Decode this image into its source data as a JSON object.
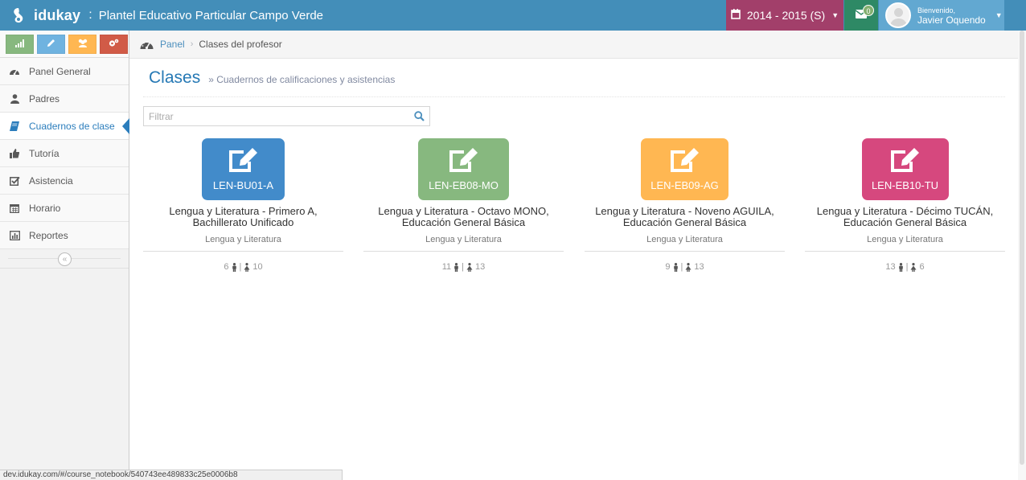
{
  "navbar": {
    "brand": "idukay",
    "separator": ":",
    "school": "Plantel Educativo Particular Campo Verde",
    "year": "2014 - 2015 (S)",
    "mail_count": "0",
    "welcome": "Bienvenido,",
    "user_name": "Javier Oquendo",
    "colors": {
      "navbar": "#438eb9",
      "year": "#a23f6a",
      "mail": "#2e8965",
      "user": "#62a8d1"
    }
  },
  "shortcuts": [
    {
      "icon": "signal-icon",
      "color": "#87b87f"
    },
    {
      "icon": "pencil-icon",
      "color": "#6fb3e0"
    },
    {
      "icon": "users-icon",
      "color": "#ffb752"
    },
    {
      "icon": "cogs-icon",
      "color": "#d15b47"
    }
  ],
  "sidebar": {
    "items": [
      {
        "label": "Panel General",
        "icon": "dashboard-icon"
      },
      {
        "label": "Padres",
        "icon": "user-icon"
      },
      {
        "label": "Cuadernos de clase",
        "icon": "book-icon",
        "active": true
      },
      {
        "label": "Tutoría",
        "icon": "thumbs-up-icon"
      },
      {
        "label": "Asistencia",
        "icon": "check-square-icon"
      },
      {
        "label": "Horario",
        "icon": "calendar-icon"
      },
      {
        "label": "Reportes",
        "icon": "bar-chart-icon"
      }
    ]
  },
  "breadcrumb": {
    "home": "Panel",
    "current": "Clases del profesor"
  },
  "header": {
    "title": "Clases",
    "subtitle": "» Cuadernos de calificaciones y asistencias"
  },
  "filter": {
    "placeholder": "Filtrar",
    "value": ""
  },
  "courses": [
    {
      "code": "LEN-BU01-A",
      "title_line1": "Lengua y Literatura - Primero A,",
      "title_line2": "Bachillerato Unificado",
      "subject": "Lengua y Literatura",
      "males": "6",
      "females": "10",
      "color": "#428bca"
    },
    {
      "code": "LEN-EB08-MO",
      "title_line1": "Lengua y Literatura - Octavo MONO,",
      "title_line2": "Educación General Básica",
      "subject": "Lengua y Literatura",
      "males": "11",
      "females": "13",
      "color": "#87b87f"
    },
    {
      "code": "LEN-EB09-AG",
      "title_line1": "Lengua y Literatura - Noveno AGUILA,",
      "title_line2": "Educación General Básica",
      "subject": "Lengua y Literatura",
      "males": "9",
      "females": "13",
      "color": "#ffb752"
    },
    {
      "code": "LEN-EB10-TU",
      "title_line1": "Lengua y Literatura - Décimo TUCÁN,",
      "title_line2": "Educación General Básica",
      "subject": "Lengua y Literatura",
      "males": "13",
      "females": "6",
      "color": "#d6487e"
    }
  ],
  "status_url": "dev.idukay.com/#/course_notebook/540743ee489833c25e0006b8"
}
